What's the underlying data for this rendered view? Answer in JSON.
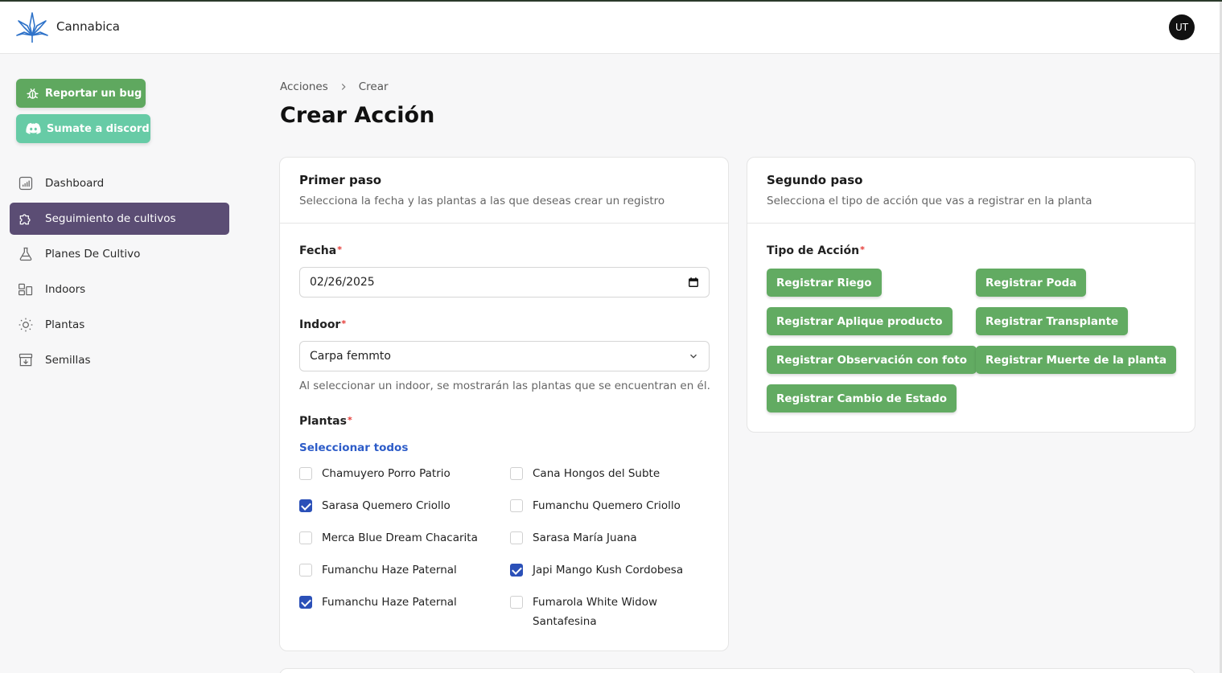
{
  "app": {
    "name": "Cannabica",
    "avatar_initials": "UT"
  },
  "sidebar": {
    "report_bug": "Reportar un bug",
    "discord": "Sumate a discord",
    "items": [
      {
        "label": "Dashboard",
        "icon": "chart-icon"
      },
      {
        "label": "Seguimiento de cultivos",
        "icon": "puzzle-icon",
        "active": true
      },
      {
        "label": "Planes De Cultivo",
        "icon": "flask-icon"
      },
      {
        "label": "Indoors",
        "icon": "layout-icon"
      },
      {
        "label": "Plantas",
        "icon": "sun-icon"
      },
      {
        "label": "Semillas",
        "icon": "archive-icon"
      }
    ]
  },
  "breadcrumb": {
    "parent": "Acciones",
    "current": "Crear"
  },
  "page_title": "Crear Acción",
  "step1": {
    "title": "Primer paso",
    "subtitle": "Selecciona la fecha y las plantas a las que deseas crear un registro",
    "date_label": "Fecha",
    "date_value": "02/26/2025",
    "indoor_label": "Indoor",
    "indoor_value": "Carpa femmto",
    "indoor_help": "Al seleccionar un indoor, se mostrarán las plantas que se encuentran en él.",
    "plants_label": "Plantas",
    "select_all": "Seleccionar todos",
    "plants": [
      {
        "name": "Chamuyero Porro Patrio",
        "checked": false
      },
      {
        "name": "Cana Hongos del Subte",
        "checked": false
      },
      {
        "name": "Sarasa Quemero Criollo",
        "checked": true
      },
      {
        "name": "Fumanchu Quemero Criollo",
        "checked": false
      },
      {
        "name": "Merca Blue Dream Chacarita",
        "checked": false
      },
      {
        "name": "Sarasa María Juana",
        "checked": false
      },
      {
        "name": "Fumanchu Haze Paternal",
        "checked": false
      },
      {
        "name": "Japi Mango Kush Cordobesa",
        "checked": true
      },
      {
        "name": "Fumanchu Haze Paternal",
        "checked": true
      },
      {
        "name": "Fumarola White Widow Santafesina",
        "checked": false
      }
    ]
  },
  "step2": {
    "title": "Segundo paso",
    "subtitle": "Selecciona el tipo de acción que vas a registrar en la planta",
    "type_label": "Tipo de Acción",
    "actions": [
      "Registrar Riego",
      "Registrar Poda",
      "Registrar Aplique producto",
      "Registrar Transplante",
      "Registrar Observación con foto",
      "Registrar Muerte de la planta",
      "Registrar Cambio de Estado"
    ]
  },
  "colors": {
    "primary_green": "#62ab62",
    "discord_teal": "#67cba6",
    "active_nav": "#5b4d74",
    "link_blue": "#2d5cc8"
  }
}
